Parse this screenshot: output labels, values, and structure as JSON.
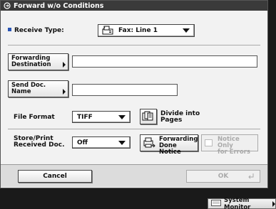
{
  "window": {
    "title": "Forward w/o Conditions"
  },
  "receive_type": {
    "label": "Receive Type:",
    "value": "Fax: Line 1"
  },
  "forwarding_destination": {
    "button_line1": "Forwarding",
    "button_line2": "Destination",
    "value": ""
  },
  "send_doc_name": {
    "button_line1": "Send Doc.",
    "button_line2": "Name",
    "value": ""
  },
  "file_format": {
    "label": "File Format",
    "value": "TIFF",
    "divide_line1": "Divide into",
    "divide_line2": "Pages"
  },
  "store_print": {
    "label_line1": "Store/Print",
    "label_line2": "Received Doc.",
    "value": "Off",
    "forwarding_line1": "Forwarding",
    "forwarding_line2": "Done Notice",
    "notice_line1": "Notice Only",
    "notice_line2": "for Errors"
  },
  "footer": {
    "cancel_label": "Cancel",
    "ok_label": "OK"
  },
  "status_bar": {
    "system_monitor_label": "System Monitor"
  },
  "colors": {
    "titlebar": "#3a3a3a",
    "accent": "#2a55b5",
    "background": "#f2f2f2"
  }
}
